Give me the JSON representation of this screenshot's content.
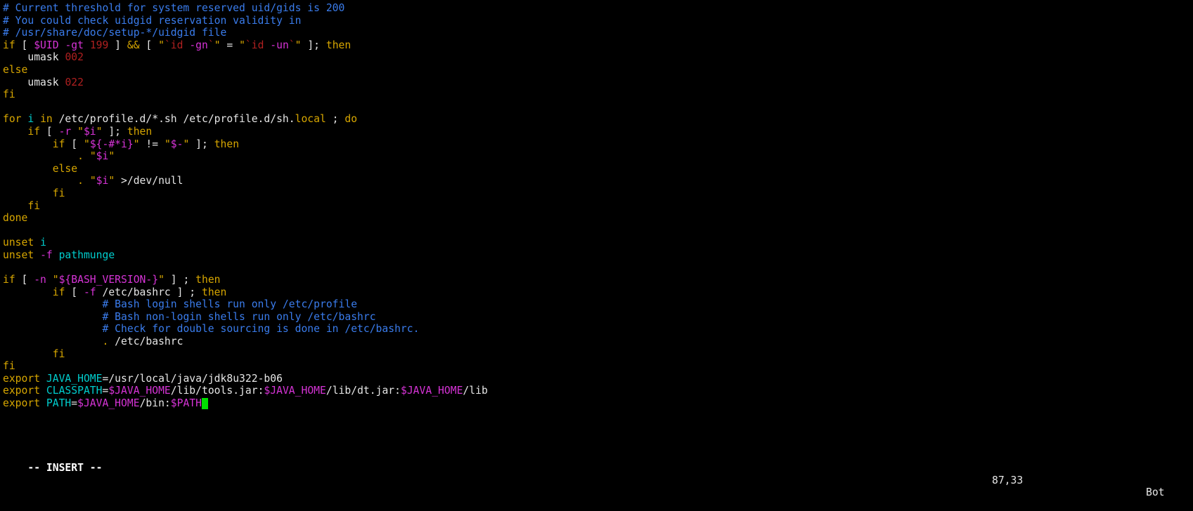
{
  "terminal": {
    "background": "#000000",
    "foreground": "#e6e6e6",
    "editor": "vim",
    "cursor_color": "#00e000"
  },
  "colors": {
    "comment": "#3a7cec",
    "statement": "#d7a600",
    "identifier": "#00cdcd",
    "variable": "#d633d6",
    "number": "#b02020",
    "string": "#b02020",
    "normal": "#e6e6e6"
  },
  "statusline": {
    "mode": "-- INSERT --",
    "ruler": "87,33",
    "filepos": "Bot"
  },
  "buffer": {
    "lines": [
      "# Current threshold for system reserved uid/gids is 200",
      "# You could check uidgid reservation validity in",
      "# /usr/share/doc/setup-*/uidgid file",
      "if [ $UID -gt 199 ] && [ \"`id -gn`\" = \"`id -un`\" ]; then",
      "    umask 002",
      "else",
      "    umask 022",
      "fi",
      "",
      "for i in /etc/profile.d/*.sh /etc/profile.d/sh.local ; do",
      "    if [ -r \"$i\" ]; then",
      "        if [ \"${-#*i}\" != \"$-\" ]; then",
      "            . \"$i\"",
      "        else",
      "            . \"$i\" >/dev/null",
      "        fi",
      "    fi",
      "done",
      "",
      "unset i",
      "unset -f pathmunge",
      "",
      "if [ -n \"${BASH_VERSION-}\" ] ; then",
      "        if [ -f /etc/bashrc ] ; then",
      "                # Bash login shells run only /etc/profile",
      "                # Bash non-login shells run only /etc/bashrc",
      "                # Check for double sourcing is done in /etc/bashrc.",
      "                . /etc/bashrc",
      "        fi",
      "fi",
      "export JAVA_HOME=/usr/local/java/jdk8u322-b06",
      "export CLASSPATH=$JAVA_HOME/lib/tools.jar:$JAVA_HOME/lib/dt.jar:$JAVA_HOME/lib",
      "export PATH=$JAVA_HOME/bin:$PATH"
    ],
    "highlighted": [
      [
        {
          "t": "# Current threshold for system reserved uid/gids is 200",
          "c": "c-comment"
        }
      ],
      [
        {
          "t": "# You could check uidgid reservation validity in",
          "c": "c-comment"
        }
      ],
      [
        {
          "t": "# /usr/share/doc/setup-*/uidgid file",
          "c": "c-comment"
        }
      ],
      [
        {
          "t": "if",
          "c": "c-stmt"
        },
        {
          "t": " [ ",
          "c": "c-plain"
        },
        {
          "t": "$UID",
          "c": "c-var"
        },
        {
          "t": " ",
          "c": "c-plain"
        },
        {
          "t": "-gt",
          "c": "c-opt"
        },
        {
          "t": " ",
          "c": "c-plain"
        },
        {
          "t": "199",
          "c": "c-num"
        },
        {
          "t": " ] ",
          "c": "c-plain"
        },
        {
          "t": "&&",
          "c": "c-op"
        },
        {
          "t": " [ ",
          "c": "c-plain"
        },
        {
          "t": "\"",
          "c": "c-quote"
        },
        {
          "t": "`id ",
          "c": "c-str"
        },
        {
          "t": "-gn",
          "c": "c-var"
        },
        {
          "t": "`",
          "c": "c-str"
        },
        {
          "t": "\"",
          "c": "c-quote"
        },
        {
          "t": " = ",
          "c": "c-plain"
        },
        {
          "t": "\"",
          "c": "c-quote"
        },
        {
          "t": "`id ",
          "c": "c-str"
        },
        {
          "t": "-un",
          "c": "c-var"
        },
        {
          "t": "`",
          "c": "c-str"
        },
        {
          "t": "\"",
          "c": "c-quote"
        },
        {
          "t": " ]; ",
          "c": "c-plain"
        },
        {
          "t": "then",
          "c": "c-stmt"
        }
      ],
      [
        {
          "t": "    ",
          "c": "c-plain"
        },
        {
          "t": "umask",
          "c": "c-plain"
        },
        {
          "t": " ",
          "c": "c-plain"
        },
        {
          "t": "002",
          "c": "c-num"
        }
      ],
      [
        {
          "t": "else",
          "c": "c-stmt"
        }
      ],
      [
        {
          "t": "    ",
          "c": "c-plain"
        },
        {
          "t": "umask",
          "c": "c-plain"
        },
        {
          "t": " ",
          "c": "c-plain"
        },
        {
          "t": "022",
          "c": "c-num"
        }
      ],
      [
        {
          "t": "fi",
          "c": "c-stmt"
        }
      ],
      [
        {
          "t": "",
          "c": "c-plain"
        }
      ],
      [
        {
          "t": "for",
          "c": "c-stmt"
        },
        {
          "t": " ",
          "c": "c-plain"
        },
        {
          "t": "i",
          "c": "c-ident"
        },
        {
          "t": " ",
          "c": "c-plain"
        },
        {
          "t": "in",
          "c": "c-stmt"
        },
        {
          "t": " /etc/profile.d/*.sh /etc/profile.d/sh.",
          "c": "c-plain"
        },
        {
          "t": "local",
          "c": "c-stmt"
        },
        {
          "t": " ; ",
          "c": "c-plain"
        },
        {
          "t": "do",
          "c": "c-stmt"
        }
      ],
      [
        {
          "t": "    ",
          "c": "c-plain"
        },
        {
          "t": "if",
          "c": "c-stmt"
        },
        {
          "t": " [ ",
          "c": "c-plain"
        },
        {
          "t": "-r",
          "c": "c-opt"
        },
        {
          "t": " ",
          "c": "c-plain"
        },
        {
          "t": "\"",
          "c": "c-quote"
        },
        {
          "t": "$i",
          "c": "c-var"
        },
        {
          "t": "\"",
          "c": "c-quote"
        },
        {
          "t": " ]; ",
          "c": "c-plain"
        },
        {
          "t": "then",
          "c": "c-stmt"
        }
      ],
      [
        {
          "t": "        ",
          "c": "c-plain"
        },
        {
          "t": "if",
          "c": "c-stmt"
        },
        {
          "t": " [ ",
          "c": "c-plain"
        },
        {
          "t": "\"",
          "c": "c-quote"
        },
        {
          "t": "${-#*i}",
          "c": "c-var"
        },
        {
          "t": "\"",
          "c": "c-quote"
        },
        {
          "t": " != ",
          "c": "c-plain"
        },
        {
          "t": "\"",
          "c": "c-quote"
        },
        {
          "t": "$-",
          "c": "c-var"
        },
        {
          "t": "\"",
          "c": "c-quote"
        },
        {
          "t": " ]; ",
          "c": "c-plain"
        },
        {
          "t": "then",
          "c": "c-stmt"
        }
      ],
      [
        {
          "t": "            ",
          "c": "c-plain"
        },
        {
          "t": ".",
          "c": "c-stmt"
        },
        {
          "t": " ",
          "c": "c-plain"
        },
        {
          "t": "\"",
          "c": "c-quote"
        },
        {
          "t": "$i",
          "c": "c-var"
        },
        {
          "t": "\"",
          "c": "c-quote"
        }
      ],
      [
        {
          "t": "        ",
          "c": "c-plain"
        },
        {
          "t": "else",
          "c": "c-stmt"
        }
      ],
      [
        {
          "t": "            ",
          "c": "c-plain"
        },
        {
          "t": ".",
          "c": "c-stmt"
        },
        {
          "t": " ",
          "c": "c-plain"
        },
        {
          "t": "\"",
          "c": "c-quote"
        },
        {
          "t": "$i",
          "c": "c-var"
        },
        {
          "t": "\"",
          "c": "c-quote"
        },
        {
          "t": " >/dev/null",
          "c": "c-plain"
        }
      ],
      [
        {
          "t": "        ",
          "c": "c-plain"
        },
        {
          "t": "fi",
          "c": "c-stmt"
        }
      ],
      [
        {
          "t": "    ",
          "c": "c-plain"
        },
        {
          "t": "fi",
          "c": "c-stmt"
        }
      ],
      [
        {
          "t": "done",
          "c": "c-stmt"
        }
      ],
      [
        {
          "t": "",
          "c": "c-plain"
        }
      ],
      [
        {
          "t": "unset",
          "c": "c-stmt"
        },
        {
          "t": " ",
          "c": "c-plain"
        },
        {
          "t": "i",
          "c": "c-ident"
        }
      ],
      [
        {
          "t": "unset",
          "c": "c-stmt"
        },
        {
          "t": " ",
          "c": "c-plain"
        },
        {
          "t": "-f",
          "c": "c-opt"
        },
        {
          "t": " ",
          "c": "c-plain"
        },
        {
          "t": "pathmunge",
          "c": "c-ident"
        }
      ],
      [
        {
          "t": "",
          "c": "c-plain"
        }
      ],
      [
        {
          "t": "if",
          "c": "c-stmt"
        },
        {
          "t": " [ ",
          "c": "c-plain"
        },
        {
          "t": "-n",
          "c": "c-opt"
        },
        {
          "t": " ",
          "c": "c-plain"
        },
        {
          "t": "\"",
          "c": "c-quote"
        },
        {
          "t": "${BASH_VERSION-}",
          "c": "c-var"
        },
        {
          "t": "\"",
          "c": "c-quote"
        },
        {
          "t": " ] ; ",
          "c": "c-plain"
        },
        {
          "t": "then",
          "c": "c-stmt"
        }
      ],
      [
        {
          "t": "        ",
          "c": "c-plain"
        },
        {
          "t": "if",
          "c": "c-stmt"
        },
        {
          "t": " [ ",
          "c": "c-plain"
        },
        {
          "t": "-f",
          "c": "c-opt"
        },
        {
          "t": " /etc/bashrc ] ; ",
          "c": "c-plain"
        },
        {
          "t": "then",
          "c": "c-stmt"
        }
      ],
      [
        {
          "t": "                ",
          "c": "c-plain"
        },
        {
          "t": "# Bash login shells run only /etc/profile",
          "c": "c-comment"
        }
      ],
      [
        {
          "t": "                ",
          "c": "c-plain"
        },
        {
          "t": "# Bash non-login shells run only /etc/bashrc",
          "c": "c-comment"
        }
      ],
      [
        {
          "t": "                ",
          "c": "c-plain"
        },
        {
          "t": "# Check for double sourcing is done in /etc/bashrc.",
          "c": "c-comment"
        }
      ],
      [
        {
          "t": "                ",
          "c": "c-plain"
        },
        {
          "t": ".",
          "c": "c-stmt"
        },
        {
          "t": " /etc/bashrc",
          "c": "c-plain"
        }
      ],
      [
        {
          "t": "        ",
          "c": "c-plain"
        },
        {
          "t": "fi",
          "c": "c-stmt"
        }
      ],
      [
        {
          "t": "fi",
          "c": "c-stmt"
        }
      ],
      [
        {
          "t": "export",
          "c": "c-stmt"
        },
        {
          "t": " ",
          "c": "c-plain"
        },
        {
          "t": "JAVA_HOME",
          "c": "c-ident"
        },
        {
          "t": "=/usr/local/java/jdk8u322-b06",
          "c": "c-plain"
        }
      ],
      [
        {
          "t": "export",
          "c": "c-stmt"
        },
        {
          "t": " ",
          "c": "c-plain"
        },
        {
          "t": "CLASSPATH",
          "c": "c-ident"
        },
        {
          "t": "=",
          "c": "c-plain"
        },
        {
          "t": "$JAVA_HOME",
          "c": "c-var"
        },
        {
          "t": "/lib/tools.jar:",
          "c": "c-plain"
        },
        {
          "t": "$JAVA_HOME",
          "c": "c-var"
        },
        {
          "t": "/lib/dt.jar:",
          "c": "c-plain"
        },
        {
          "t": "$JAVA_HOME",
          "c": "c-var"
        },
        {
          "t": "/lib",
          "c": "c-plain"
        }
      ],
      [
        {
          "t": "export",
          "c": "c-stmt"
        },
        {
          "t": " ",
          "c": "c-plain"
        },
        {
          "t": "PATH",
          "c": "c-ident"
        },
        {
          "t": "=",
          "c": "c-plain"
        },
        {
          "t": "$JAVA_HOME",
          "c": "c-var"
        },
        {
          "t": "/bin:",
          "c": "c-plain"
        },
        {
          "t": "$PATH",
          "c": "c-var"
        },
        {
          "t": "",
          "c": "cursor-here"
        }
      ]
    ]
  }
}
